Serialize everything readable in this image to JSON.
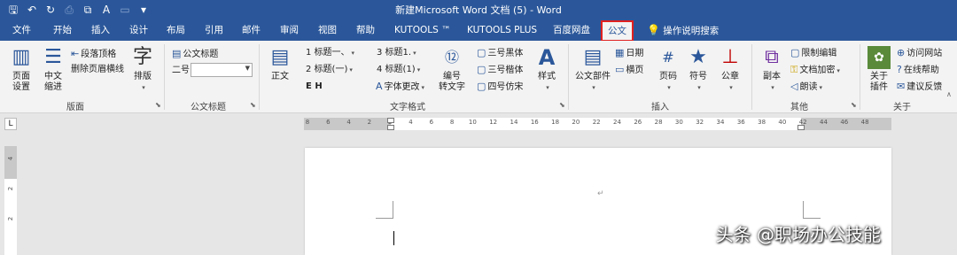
{
  "window": {
    "title": "新建Microsoft Word 文档 (5)  -  Word"
  },
  "quick_access": [
    "save-icon",
    "undo-icon",
    "redo-icon",
    "print-icon",
    "format-painter-icon",
    "spelling-icon",
    "screenshot-icon",
    "customize-icon"
  ],
  "menu": {
    "tabs": [
      "文件",
      "开始",
      "插入",
      "设计",
      "布局",
      "引用",
      "邮件",
      "审阅",
      "视图",
      "帮助",
      "KUTOOLS ™",
      "KUTOOLS PLUS",
      "百度网盘",
      "公文"
    ],
    "active_tab": "公文",
    "search_label": "操作说明搜索"
  },
  "ribbon": {
    "layout_group": {
      "label": "版面",
      "page_setup": "页面\n设置",
      "chinese_indent": "中文\n缩进",
      "paragraph_top": "段落顶格",
      "remove_header_line": "删除页眉横线",
      "typeset": "排版",
      "typeset_glyph": "字"
    },
    "doc_title_group": {
      "label": "公文标题",
      "doc_title_btn": "公文标题",
      "size_label": "二号",
      "size_value": ""
    },
    "text_format_group": {
      "label": "文字格式",
      "heading_1": "1  标题一、",
      "heading_2": "2  标题(一)",
      "heading_3": "3  标题1.",
      "heading_4": "4  标题(1)",
      "body_text": "正文",
      "font_change": "字体更改",
      "bold_marks": "E   H",
      "number_to_text": "编号\n转文字",
      "font_1": "三号黑体",
      "font_2": "三号楷体",
      "font_3": "四号仿宋",
      "style": "样式"
    },
    "insert_group": {
      "label": "插入",
      "doc_parts": "公文部件",
      "date": "日期",
      "landscape": "横页",
      "page_number": "页码",
      "symbol": "符号",
      "seal": "公章"
    },
    "other_group": {
      "label": "其他",
      "copy": "副本",
      "restrict_edit": "限制编辑",
      "encrypt": "文档加密",
      "read_aloud": "朗读"
    },
    "about_group": {
      "label": "关于",
      "about_plugin": "关于\n插件",
      "visit_site": "访问网站",
      "online_help": "在线帮助",
      "feedback": "建议反馈"
    }
  },
  "ruler": {
    "ticks": [
      "8",
      "6",
      "4",
      "2",
      "2",
      "4",
      "6",
      "8",
      "10",
      "12",
      "14",
      "16",
      "18",
      "20",
      "22",
      "24",
      "26",
      "28",
      "30",
      "32",
      "34",
      "36",
      "38",
      "40",
      "42",
      "44",
      "46",
      "48"
    ],
    "vertical_ticks": [
      "4",
      "2",
      "2"
    ]
  },
  "document": {
    "paragraph_mark": "↵"
  },
  "watermark": "头条 @职场办公技能"
}
